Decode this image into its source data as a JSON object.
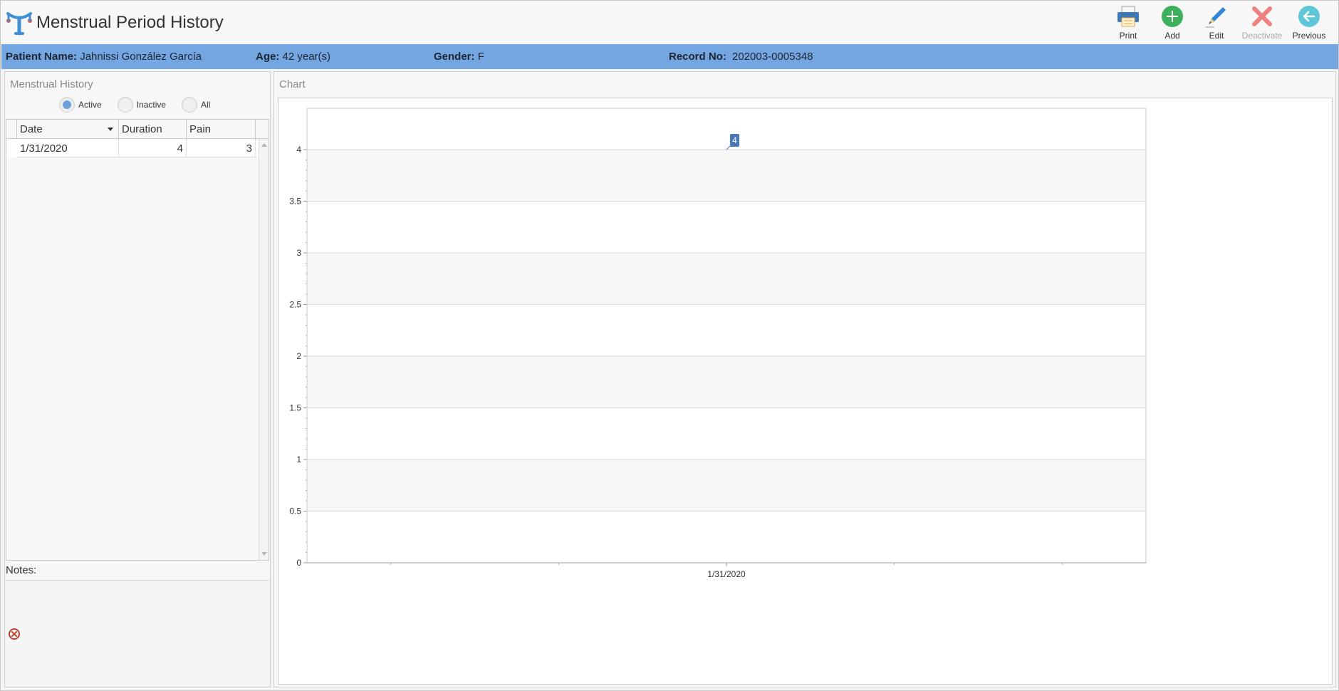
{
  "header": {
    "title": "Menstrual Period History",
    "toolbar": [
      {
        "id": "print",
        "label": "Print",
        "icon": "printer-icon",
        "enabled": true
      },
      {
        "id": "add",
        "label": "Add",
        "icon": "plus-circle-icon",
        "enabled": true
      },
      {
        "id": "edit",
        "label": "Edit",
        "icon": "pencil-icon",
        "enabled": true
      },
      {
        "id": "deactivate",
        "label": "Deactivate",
        "icon": "x-icon",
        "enabled": false
      },
      {
        "id": "previous",
        "label": "Previous",
        "icon": "arrow-left-circle-icon",
        "enabled": true
      }
    ]
  },
  "patient": {
    "name_label": "Patient Name:",
    "name": "Jahnissi González García",
    "age_label": "Age:",
    "age": "42 year(s)",
    "gender_label": "Gender:",
    "gender": "F",
    "record_label": "Record No:",
    "record": "202003-0005348"
  },
  "history": {
    "title": "Menstrual History",
    "filters": [
      {
        "label": "Active",
        "selected": true
      },
      {
        "label": "Inactive",
        "selected": false
      },
      {
        "label": "All",
        "selected": false
      }
    ],
    "columns": [
      "Date",
      "Duration",
      "Pain"
    ],
    "rows": [
      {
        "date": "1/31/2020",
        "duration": "4",
        "pain": "3"
      }
    ],
    "notes_label": "Notes:"
  },
  "chart_panel": {
    "title": "Chart"
  },
  "colors": {
    "accent": "#74a6e1",
    "series": "#4a78b4",
    "add": "#3cb05a",
    "deactivate": "#f07f7f",
    "previous": "#5fc6d8"
  },
  "chart_data": {
    "type": "line",
    "categories": [
      "1/31/2020"
    ],
    "series": [
      {
        "values": [
          4
        ]
      }
    ],
    "data_labels": [
      "4"
    ],
    "y_ticks": [
      "0",
      "0.5",
      "1",
      "1.5",
      "2",
      "2.5",
      "3",
      "3.5",
      "4"
    ],
    "ylim": [
      0,
      4.4
    ],
    "grid": "horizontal",
    "banded_background": true,
    "legend": "none"
  }
}
